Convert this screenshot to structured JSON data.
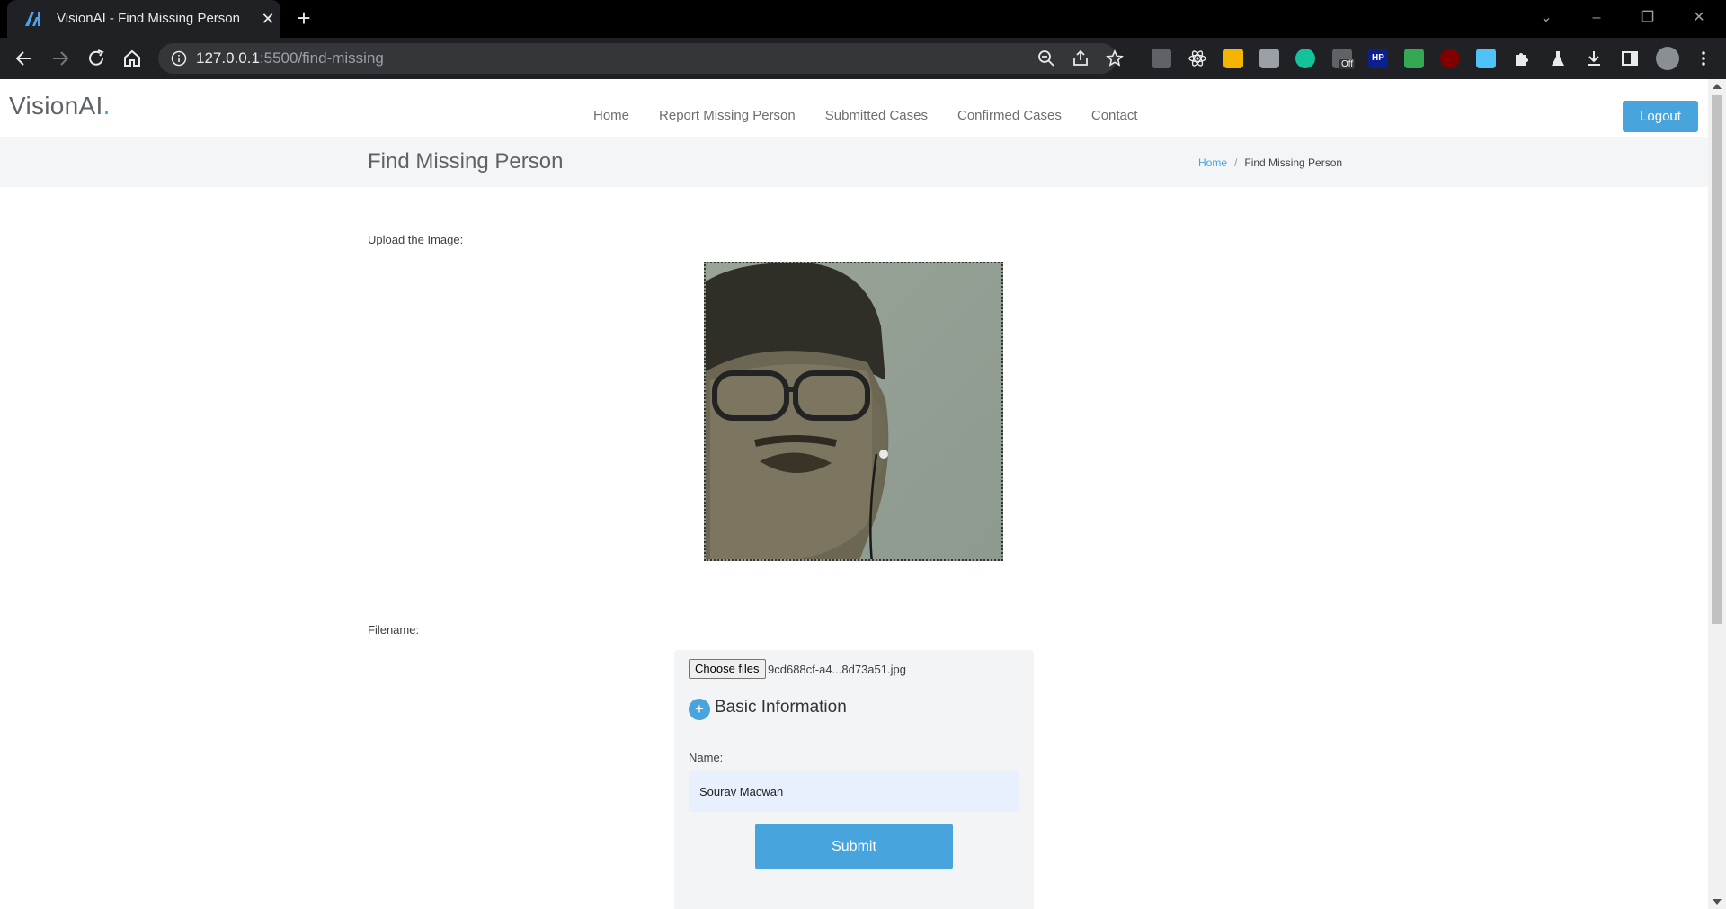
{
  "browser": {
    "tab_title": "VisionAI - Find Missing Person",
    "url_host": "127.0.0.1",
    "url_path": ":5500/find-missing",
    "extension_badge": "Off",
    "hp_badge": "HP"
  },
  "navbar": {
    "logo_text": "VisionAI",
    "logo_dot": ".",
    "links": [
      "Home",
      "Report Missing Person",
      "Submitted Cases",
      "Confirmed Cases",
      "Contact"
    ],
    "logout_label": "Logout"
  },
  "page": {
    "title": "Find Missing Person",
    "breadcrumb": {
      "home": "Home",
      "separator": "/",
      "current": "Find Missing Person"
    },
    "upload_label": "Upload the Image:",
    "filename_label": "Filename:"
  },
  "form": {
    "choose_files_label": "Choose files",
    "file_name": "9cd688cf-a4...8d73a51.jpg",
    "section_icon": "+",
    "section_title": "Basic Information",
    "name_label": "Name:",
    "name_value": "Sourav Macwan",
    "submit_label": "Submit"
  },
  "colors": {
    "accent": "#47a4dc",
    "chrome_dark": "#202124",
    "page_bar": "#f3f5f6"
  }
}
